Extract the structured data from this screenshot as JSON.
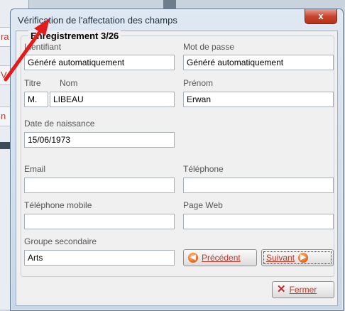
{
  "background": {
    "tab_glyphs": [
      "ra",
      "V",
      "n"
    ]
  },
  "dialog": {
    "title": "Vérification de l'affectation des champs",
    "close_glyph": "x",
    "group_title": "Enregistrement 3/26",
    "labels": {
      "identifiant": "Identifiant",
      "mot_de_passe": "Mot de passe",
      "titre": "Titre",
      "nom": "Nom",
      "prenom": "Prénom",
      "date_naissance": "Date de naissance",
      "email": "Email",
      "telephone": "Téléphone",
      "telephone_mobile": "Téléphone mobile",
      "page_web": "Page Web",
      "groupe_secondaire": "Groupe secondaire"
    },
    "values": {
      "identifiant": "Généré automatiquement",
      "mot_de_passe": "Généré automatiquement",
      "titre": "M.",
      "nom": "LIBEAU",
      "prenom": "Erwan",
      "date_naissance": "15/06/1973",
      "email": "",
      "telephone": "",
      "telephone_mobile": "",
      "page_web": "",
      "groupe_secondaire": "Arts"
    },
    "buttons": {
      "precedent": "Précédent",
      "suivant": "Suivant",
      "fermer": "Fermer"
    }
  },
  "colors": {
    "accent_orange": "#e8611a",
    "close_red": "#c8452d",
    "annotation_red": "#e31b1b"
  }
}
